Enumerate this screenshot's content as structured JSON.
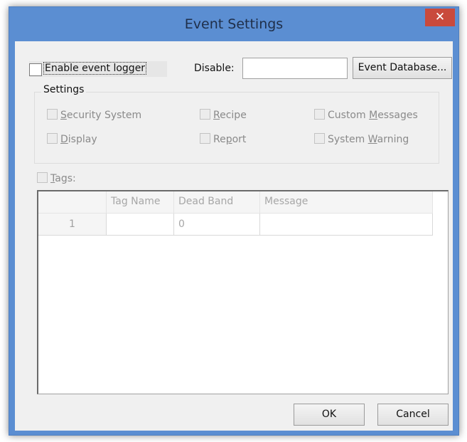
{
  "window": {
    "title": "Event Settings",
    "close_glyph": "✕"
  },
  "top_row": {
    "enable_label": "Enable event logger",
    "disable_label": "Disable:",
    "disable_value": "",
    "event_db_button": "Event Database..."
  },
  "settings": {
    "legend": "Settings",
    "options": {
      "security_system": {
        "pre": "",
        "u": "S",
        "post": "ecurity System",
        "checked": false
      },
      "recipe": {
        "pre": "",
        "u": "R",
        "post": "ecipe",
        "checked": false
      },
      "custom_messages": {
        "pre": "Custom ",
        "u": "M",
        "post": "essages",
        "checked": false
      },
      "display": {
        "pre": "",
        "u": "D",
        "post": "isplay",
        "checked": false
      },
      "report": {
        "pre": "Re",
        "u": "p",
        "post": "ort",
        "checked": false
      },
      "system_warning": {
        "pre": "System ",
        "u": "W",
        "post": "arning",
        "checked": false
      }
    }
  },
  "tags": {
    "pre": "",
    "u": "T",
    "post": "ags:",
    "checked": false
  },
  "grid": {
    "headers": [
      "",
      "Tag Name",
      "Dead Band",
      "Message"
    ],
    "rows": [
      {
        "num": "1",
        "tag_name": "",
        "dead_band": "0",
        "message": ""
      }
    ]
  },
  "buttons": {
    "ok": "OK",
    "cancel": "Cancel"
  },
  "colors": {
    "titlebar": "#5b8ed2",
    "close": "#c94a3c",
    "client": "#f0f0f0"
  }
}
